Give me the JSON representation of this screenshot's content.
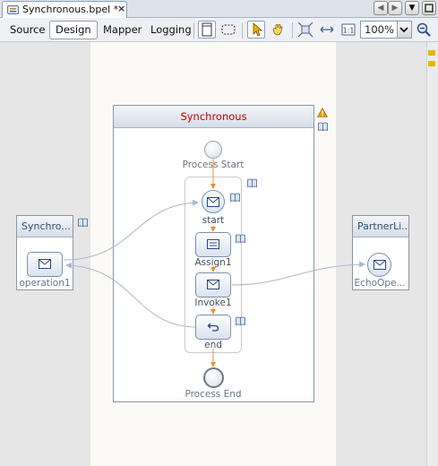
{
  "tab": {
    "title": "Synchronous.bpel *",
    "close": "×"
  },
  "views": {
    "source": "Source",
    "design": "Design",
    "mapper": "Mapper",
    "logging": "Logging"
  },
  "zoom": {
    "value": "100%"
  },
  "process": {
    "name": "Synchronous",
    "start_label": "Process Start",
    "end_label": "Process End",
    "activities": [
      "start",
      "Assign1",
      "Invoke1",
      "end"
    ]
  },
  "partners": {
    "left": {
      "name": "Synchro...",
      "operation": "operation1"
    },
    "right": {
      "name": "PartnerLi...",
      "operation": "EchoOpe..."
    }
  },
  "colors": {
    "warning": "#e8a000",
    "process_title": "#c00000",
    "flow": "#e8902e",
    "link": "#aab6cf"
  }
}
